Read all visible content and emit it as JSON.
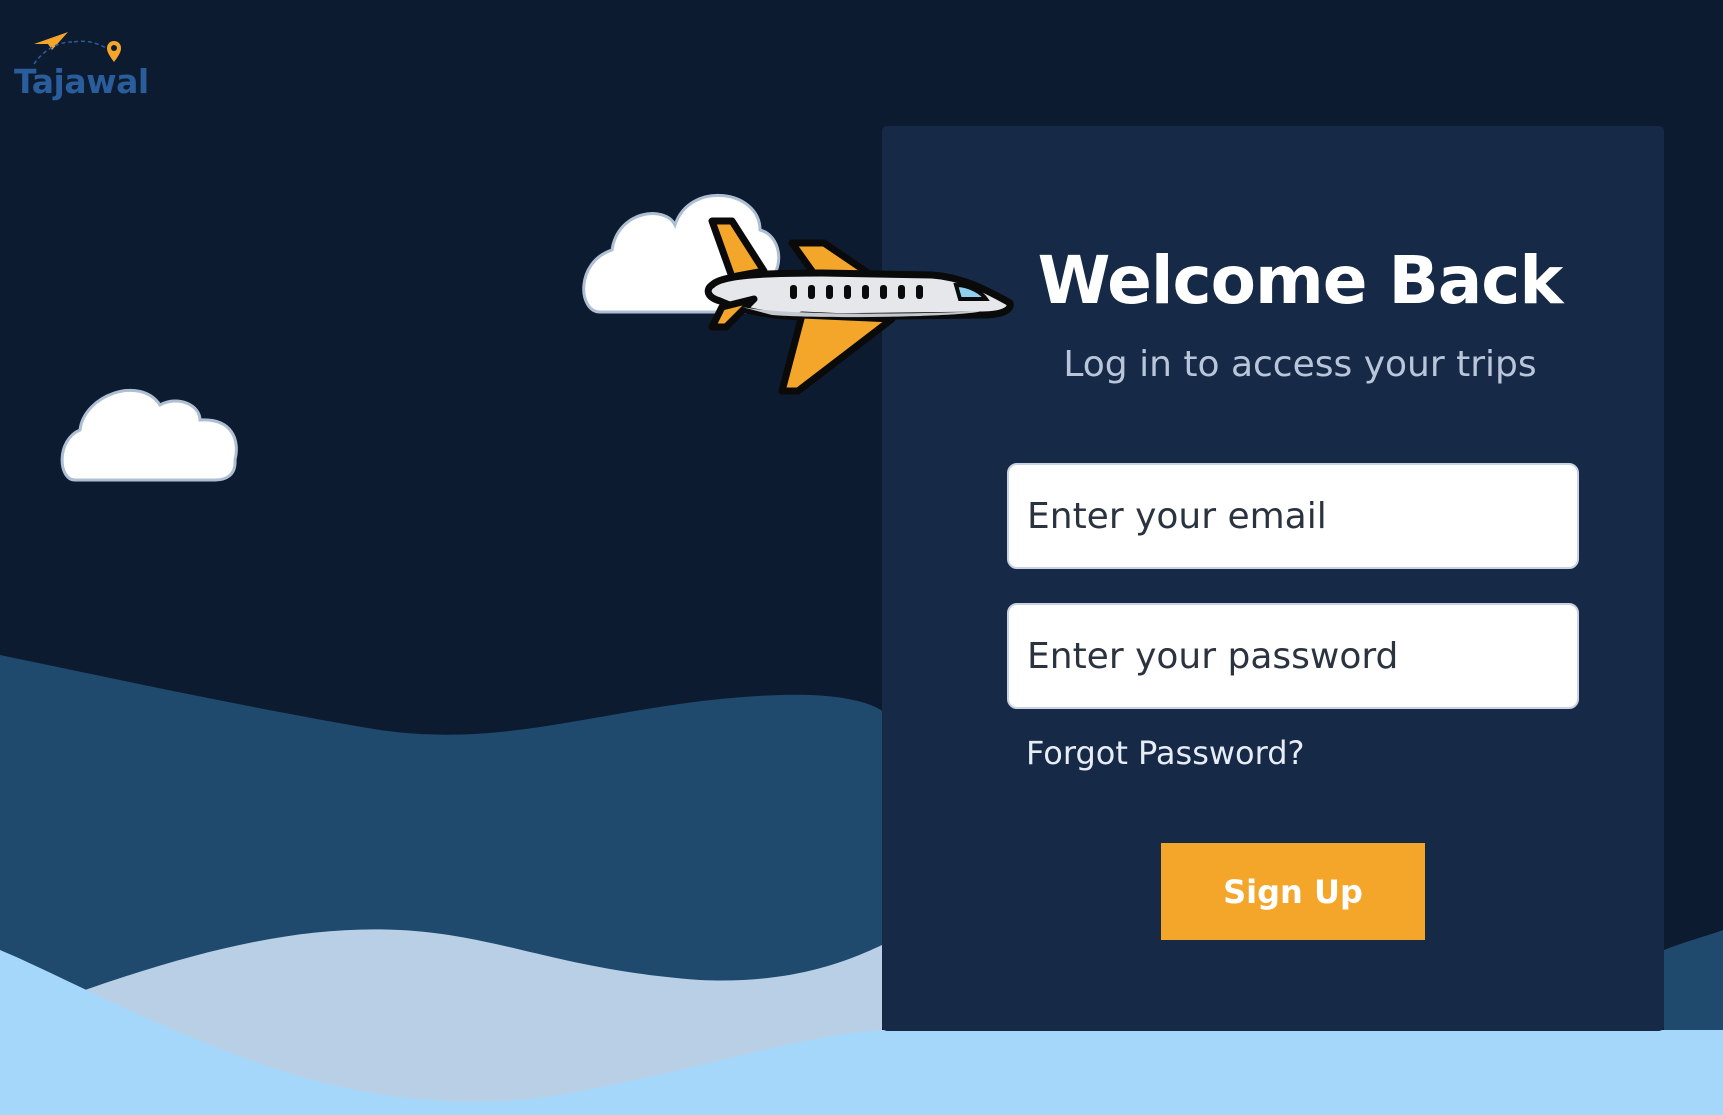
{
  "brand": {
    "name": "Tajawal"
  },
  "login": {
    "title": "Welcome Back",
    "subtitle": "Log in to access your trips",
    "email_placeholder": "Enter your email",
    "password_placeholder": "Enter your password",
    "forgot_label": "Forgot Password?",
    "submit_label": "Sign Up"
  },
  "colors": {
    "night_sky": "#0d1b30",
    "card": "#162a48",
    "wave_dark": "#1f4a6e",
    "wave_light": "#b8cfe6",
    "wave_sky": "#a5d7fb",
    "accent": "#f4a62a",
    "brand_blue": "#2a5d9c"
  },
  "icons": [
    "paper-plane-icon",
    "map-pin-icon",
    "cloud-icon",
    "airplane-icon"
  ]
}
